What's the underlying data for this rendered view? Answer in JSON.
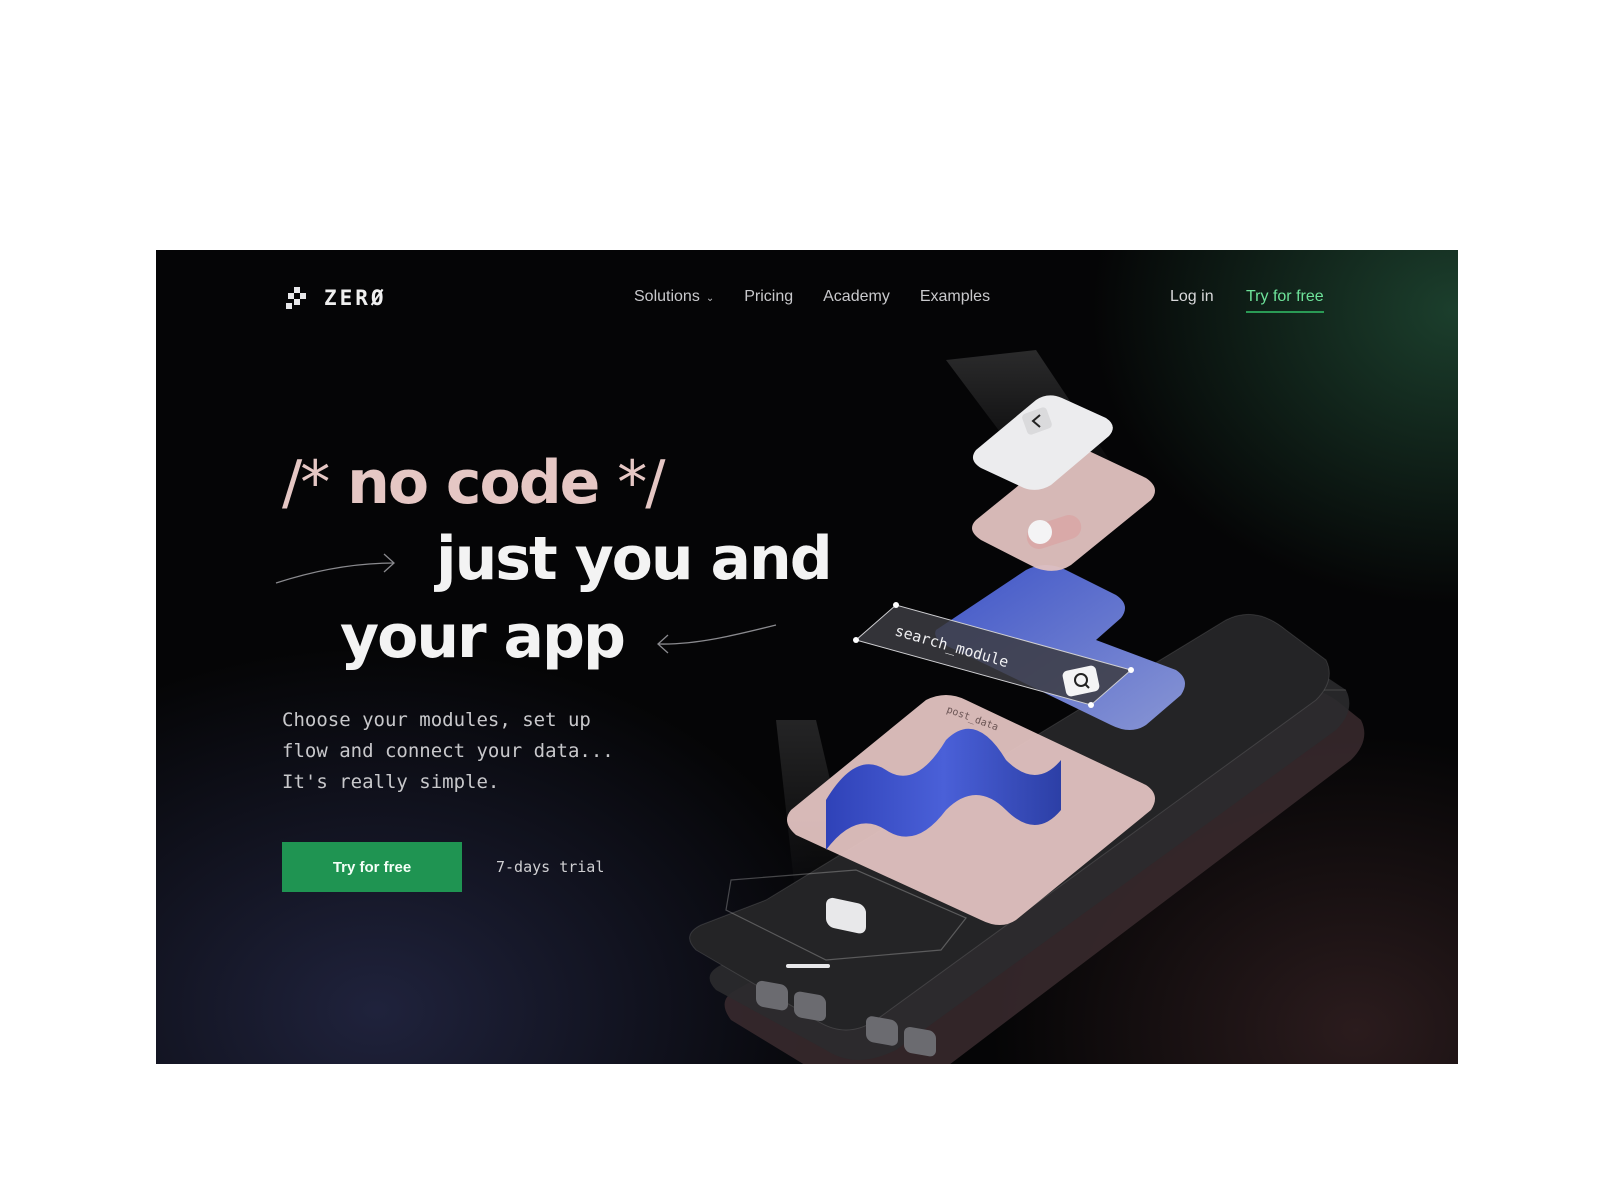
{
  "brand": {
    "name": "ZERØ"
  },
  "nav": {
    "items": [
      {
        "label": "Solutions",
        "has_dropdown": true
      },
      {
        "label": "Pricing"
      },
      {
        "label": "Academy"
      },
      {
        "label": "Examples"
      }
    ],
    "login_label": "Log in",
    "try_label": "Try for free"
  },
  "hero": {
    "line1_comment_open": "/*",
    "line1_text": "no code",
    "line1_comment_close": "*/",
    "line2": "just you and",
    "line3": "your app",
    "subtitle": "Choose your modules, set up\nflow and connect your data...\nIt's really simple.",
    "cta_label": "Try for free",
    "trial_label": "7-days trial"
  },
  "illustration": {
    "search_label": "search_module",
    "post_label": "post_data"
  },
  "colors": {
    "accent_green": "#1f9452",
    "link_green": "#6ee39a",
    "headline_pink": "#e5c7c4",
    "background": "#050506"
  },
  "icons": [
    "logo-mark-icon",
    "chevron-down-icon",
    "arrow-right-icon",
    "arrow-left-icon",
    "back-arrow-icon",
    "search-icon"
  ]
}
